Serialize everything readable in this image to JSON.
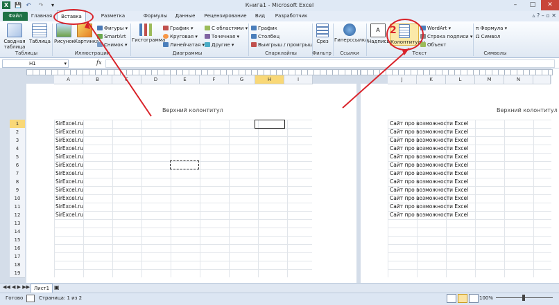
{
  "window": {
    "title": "Книга1 - Microsoft Excel",
    "min": "–",
    "max": "□",
    "close": "✕"
  },
  "qat": {
    "save": "💾",
    "undo": "↶",
    "redo": "↷",
    "more": "▾"
  },
  "tabs": [
    {
      "label": "Файл"
    },
    {
      "label": "Главная"
    },
    {
      "label": "Вставка"
    },
    {
      "label": "Разметка страницы"
    },
    {
      "label": "Формулы"
    },
    {
      "label": "Данные"
    },
    {
      "label": "Рецензирование"
    },
    {
      "label": "Вид"
    },
    {
      "label": "Разработчик"
    }
  ],
  "ribbon": {
    "tables": {
      "label": "Таблицы",
      "pivot": "Сводная таблица",
      "table": "Таблица"
    },
    "illustrations": {
      "label": "Иллюстрации",
      "picture": "Рисунок",
      "clipart": "Картинка",
      "shapes": "Фигуры",
      "smartart": "SmartArt",
      "screenshot": "Снимок"
    },
    "charts": {
      "label": "Диаграммы",
      "histogram": "Гистограмма",
      "graph": "График",
      "pie": "Круговая",
      "bar": "Линейчатая",
      "area": "С областями",
      "scatter": "Точечная",
      "other": "Другие"
    },
    "sparklines": {
      "label": "Спарклайны",
      "graph": "График",
      "column": "Столбец",
      "winloss": "Выигрыш / проигрыш"
    },
    "filter": {
      "label": "Фильтр",
      "slicer": "Срез"
    },
    "links": {
      "label": "Ссылки",
      "hyperlink": "Гиперссылка"
    },
    "text": {
      "label": "Текст",
      "textbox": "Надпись",
      "headerfooter": "Колонтитулы",
      "wordart": "WordArt",
      "signature": "Строка подписи",
      "object": "Объект"
    },
    "symbols": {
      "label": "Символы",
      "formula": "Формула",
      "symbol": "Символ"
    }
  },
  "formula_bar": {
    "namebox": "H1",
    "fx": "fx",
    "value": ""
  },
  "columns_left": [
    "A",
    "B",
    "C",
    "D",
    "E",
    "F",
    "G",
    "H",
    "I"
  ],
  "columns_right": [
    "J",
    "K",
    "L",
    "M",
    "N"
  ],
  "rows": [
    "1",
    "2",
    "3",
    "4",
    "5",
    "6",
    "7",
    "8",
    "9",
    "10",
    "11",
    "12",
    "13",
    "14",
    "15",
    "16",
    "17",
    "18",
    "19"
  ],
  "page1": {
    "header": "Верхний колонтитул",
    "cells": [
      "SirExcel.ru",
      "SirExcel.ru",
      "SirExcel.ru",
      "SirExcel.ru",
      "SirExcel.ru",
      "SirExcel.ru",
      "SirExcel.ru",
      "SirExcel.ru",
      "SirExcel.ru",
      "SirExcel.ru",
      "SirExcel.ru",
      "SirExcel.ru"
    ]
  },
  "page2": {
    "header": "Верхний колонтитул",
    "cells": [
      "Сайт про возможности Excel",
      "Сайт про возможности Excel",
      "Сайт про возможности Excel",
      "Сайт про возможности Excel",
      "Сайт про возможности Excel",
      "Сайт про возможности Excel",
      "Сайт про возможности Excel",
      "Сайт про возможности Excel",
      "Сайт про возможности Excel",
      "Сайт про возможности Excel",
      "Сайт про возможности Excel",
      "Сайт про возможности Excel"
    ]
  },
  "sheets": [
    {
      "label": "Лист1"
    }
  ],
  "status": {
    "ready": "Готово",
    "page": "Страница: 1 из 2",
    "zoom": "100%"
  },
  "annotation": {
    "step": "2",
    "color": "#d9232a"
  }
}
